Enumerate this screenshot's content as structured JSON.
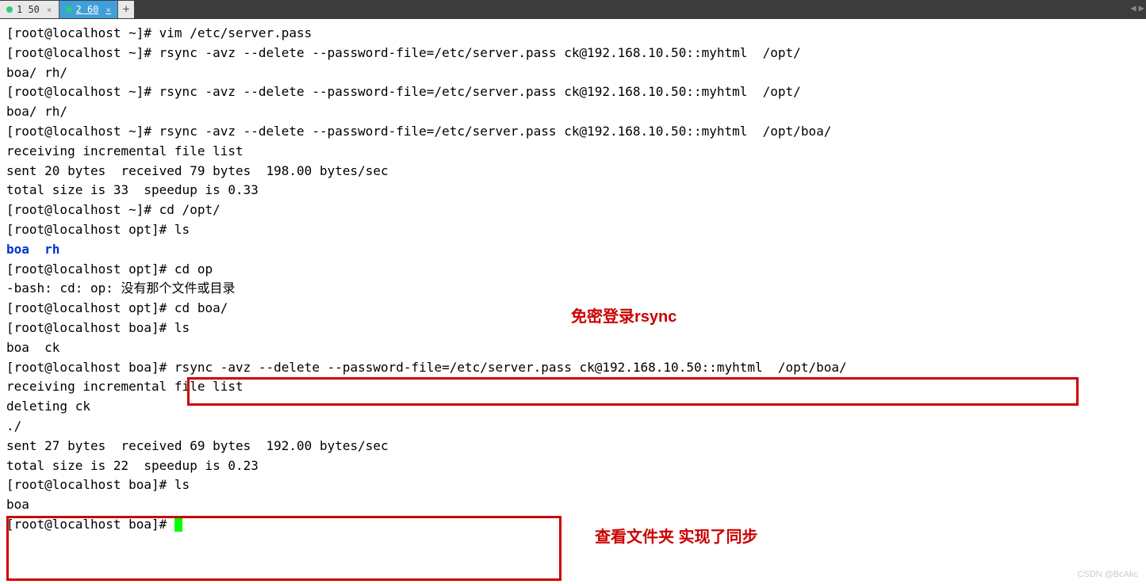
{
  "tabs": {
    "tab1": {
      "label": "1 50"
    },
    "tab2": {
      "label": "2 60"
    },
    "add": "+",
    "arrows": "◀ ▶"
  },
  "terminal_lines": {
    "l0": "[root@localhost ~]# vim /etc/server.pass",
    "l1": "[root@localhost ~]# rsync -avz --delete --password-file=/etc/server.pass ck@192.168.10.50::myhtml  /opt/",
    "l2": "boa/ rh/",
    "l3": "[root@localhost ~]# rsync -avz --delete --password-file=/etc/server.pass ck@192.168.10.50::myhtml  /opt/",
    "l4": "boa/ rh/",
    "l5": "[root@localhost ~]# rsync -avz --delete --password-file=/etc/server.pass ck@192.168.10.50::myhtml  /opt/boa/",
    "l6": "receiving incremental file list",
    "l7": "",
    "l8": "sent 20 bytes  received 79 bytes  198.00 bytes/sec",
    "l9": "total size is 33  speedup is 0.33",
    "l10": "[root@localhost ~]# cd /opt/",
    "l11": "[root@localhost opt]# ls",
    "l12a": "boa",
    "l12b": "rh",
    "l13": "[root@localhost opt]# cd op",
    "l14": "-bash: cd: op: 没有那个文件或目录",
    "l15": "[root@localhost opt]# cd boa/",
    "l16": "[root@localhost boa]# ls",
    "l17": "boa  ck",
    "l18": "[root@localhost boa]# rsync -avz --delete --password-file=/etc/server.pass ck@192.168.10.50::myhtml  /opt/boa/",
    "l19": "receiving incremental file list",
    "l20": "deleting ck",
    "l21": "./",
    "l22": "",
    "l23": "sent 27 bytes  received 69 bytes  192.00 bytes/sec",
    "l24": "total size is 22  speedup is 0.23",
    "l25": "[root@localhost boa]# ls",
    "l26": "boa",
    "l27": "[root@localhost boa]# "
  },
  "annotations": {
    "a1": "免密登录rsync",
    "a2": "查看文件夹 实现了同步"
  },
  "watermark": "CSDN @BcAkc"
}
